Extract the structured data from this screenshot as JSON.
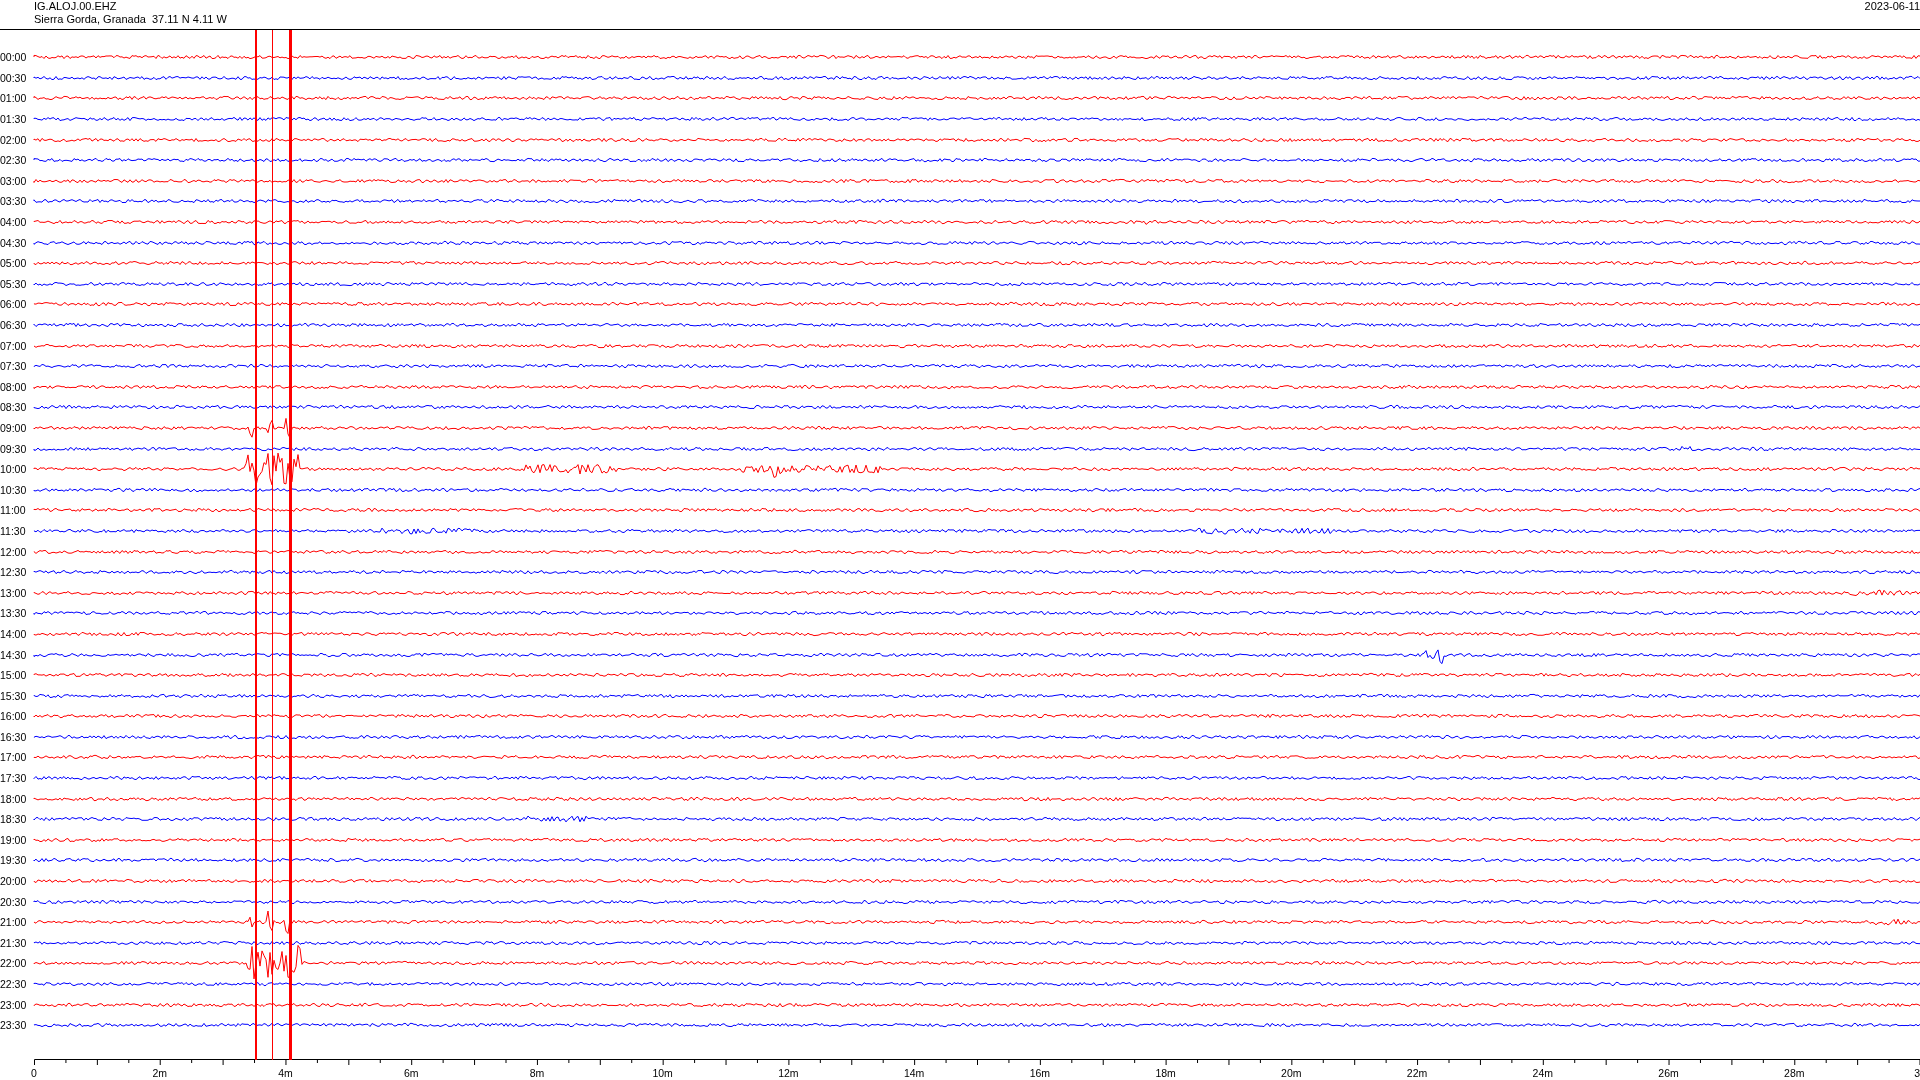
{
  "header": {
    "station": "IG.ALOJ.00.EHZ",
    "location": "Sierra Gorda, Granada  37.11 N 4.11 W",
    "date": "2023-06-11"
  },
  "helicorder": {
    "rows": [
      {
        "time": "00:00",
        "color": "#ff0000"
      },
      {
        "time": "00:30",
        "color": "#0000ff"
      },
      {
        "time": "01:00",
        "color": "#ff0000"
      },
      {
        "time": "01:30",
        "color": "#0000ff"
      },
      {
        "time": "02:00",
        "color": "#ff0000"
      },
      {
        "time": "02:30",
        "color": "#0000ff"
      },
      {
        "time": "03:00",
        "color": "#ff0000"
      },
      {
        "time": "03:30",
        "color": "#0000ff"
      },
      {
        "time": "04:00",
        "color": "#ff0000"
      },
      {
        "time": "04:30",
        "color": "#0000ff"
      },
      {
        "time": "05:00",
        "color": "#ff0000"
      },
      {
        "time": "05:30",
        "color": "#0000ff"
      },
      {
        "time": "06:00",
        "color": "#ff0000"
      },
      {
        "time": "06:30",
        "color": "#0000ff"
      },
      {
        "time": "07:00",
        "color": "#ff0000"
      },
      {
        "time": "07:30",
        "color": "#0000ff"
      },
      {
        "time": "08:00",
        "color": "#ff0000"
      },
      {
        "time": "08:30",
        "color": "#0000ff"
      },
      {
        "time": "09:00",
        "color": "#ff0000"
      },
      {
        "time": "09:30",
        "color": "#0000ff"
      },
      {
        "time": "10:00",
        "color": "#ff0000"
      },
      {
        "time": "10:30",
        "color": "#0000ff"
      },
      {
        "time": "11:00",
        "color": "#ff0000"
      },
      {
        "time": "11:30",
        "color": "#0000ff"
      },
      {
        "time": "12:00",
        "color": "#ff0000"
      },
      {
        "time": "12:30",
        "color": "#0000ff"
      },
      {
        "time": "13:00",
        "color": "#ff0000"
      },
      {
        "time": "13:30",
        "color": "#0000ff"
      },
      {
        "time": "14:00",
        "color": "#ff0000"
      },
      {
        "time": "14:30",
        "color": "#0000ff"
      },
      {
        "time": "15:00",
        "color": "#ff0000"
      },
      {
        "time": "15:30",
        "color": "#0000ff"
      },
      {
        "time": "16:00",
        "color": "#ff0000"
      },
      {
        "time": "16:30",
        "color": "#0000ff"
      },
      {
        "time": "17:00",
        "color": "#ff0000"
      },
      {
        "time": "17:30",
        "color": "#0000ff"
      },
      {
        "time": "18:00",
        "color": "#ff0000"
      },
      {
        "time": "18:30",
        "color": "#0000ff"
      },
      {
        "time": "19:00",
        "color": "#ff0000"
      },
      {
        "time": "19:30",
        "color": "#0000ff"
      },
      {
        "time": "20:00",
        "color": "#ff0000"
      },
      {
        "time": "20:30",
        "color": "#0000ff"
      },
      {
        "time": "21:00",
        "color": "#ff0000"
      },
      {
        "time": "21:30",
        "color": "#0000ff"
      },
      {
        "time": "22:00",
        "color": "#ff0000"
      },
      {
        "time": "22:30",
        "color": "#0000ff"
      },
      {
        "time": "23:00",
        "color": "#ff0000"
      },
      {
        "time": "23:30",
        "color": "#0000ff"
      }
    ],
    "x_axis_labels": [
      "0",
      "2m",
      "4m",
      "6m",
      "8m",
      "10m",
      "12m",
      "14m",
      "16m",
      "18m",
      "20m",
      "22m",
      "24m",
      "26m",
      "28m",
      "3"
    ]
  }
}
